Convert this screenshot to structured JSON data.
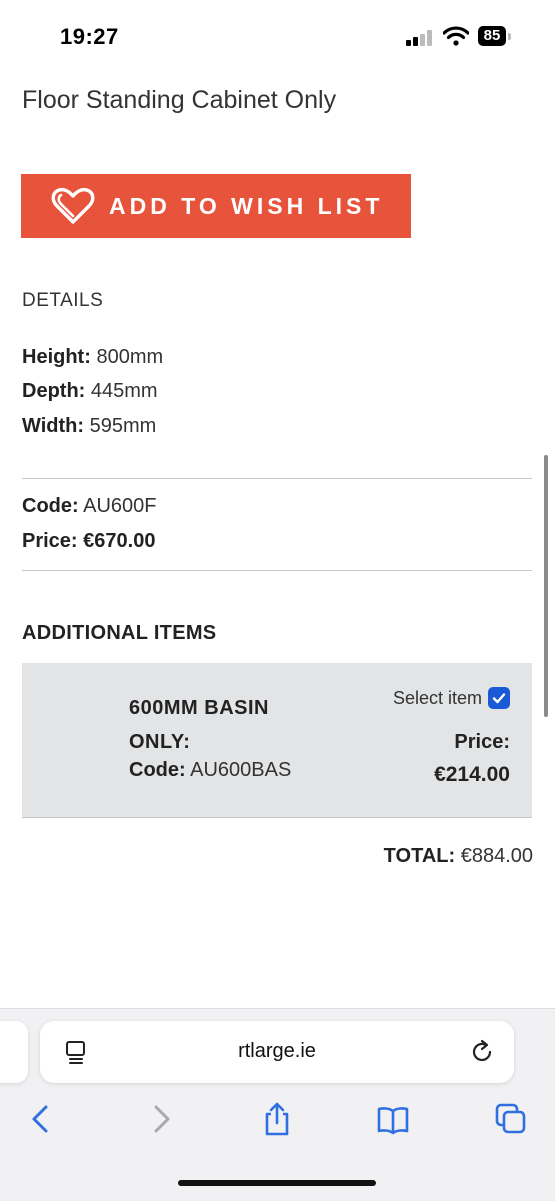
{
  "status_bar": {
    "time": "19:27",
    "battery": "85"
  },
  "product": {
    "title": "Floor Standing Cabinet Only",
    "wishlist_label": "ADD TO WISH LIST",
    "details_heading": "DETAILS",
    "specs": [
      {
        "label": "Height:",
        "value": "800mm"
      },
      {
        "label": "Depth:",
        "value": "445mm"
      },
      {
        "label": "Width:",
        "value": "595mm"
      }
    ],
    "code_label": "Code:",
    "code_value": "AU600F",
    "price_label": "Price:",
    "price_value": "€670.00"
  },
  "additional": {
    "heading": "ADDITIONAL ITEMS",
    "item": {
      "name": "600MM BASIN ONLY:",
      "code_label": "Code:",
      "code_value": "AU600BAS",
      "select_label": "Select item",
      "selected": true,
      "price_label": "Price:",
      "price_value": "€214.00"
    }
  },
  "total": {
    "label": "TOTAL:",
    "value": "€884.00"
  },
  "browser": {
    "url": "rtlarge.ie"
  },
  "colors": {
    "accent": "#e8533b",
    "checkbox": "#1a5ad6",
    "card_bg": "#e3e4e6",
    "toolbar_icon": "#2f6fe0"
  },
  "icons": [
    "signal-icon",
    "wifi-icon",
    "battery-icon",
    "heart-icon",
    "checkbox-icon",
    "reader-icon",
    "reload-icon",
    "back-icon",
    "forward-icon",
    "share-icon",
    "bookmarks-icon",
    "tabs-icon"
  ]
}
